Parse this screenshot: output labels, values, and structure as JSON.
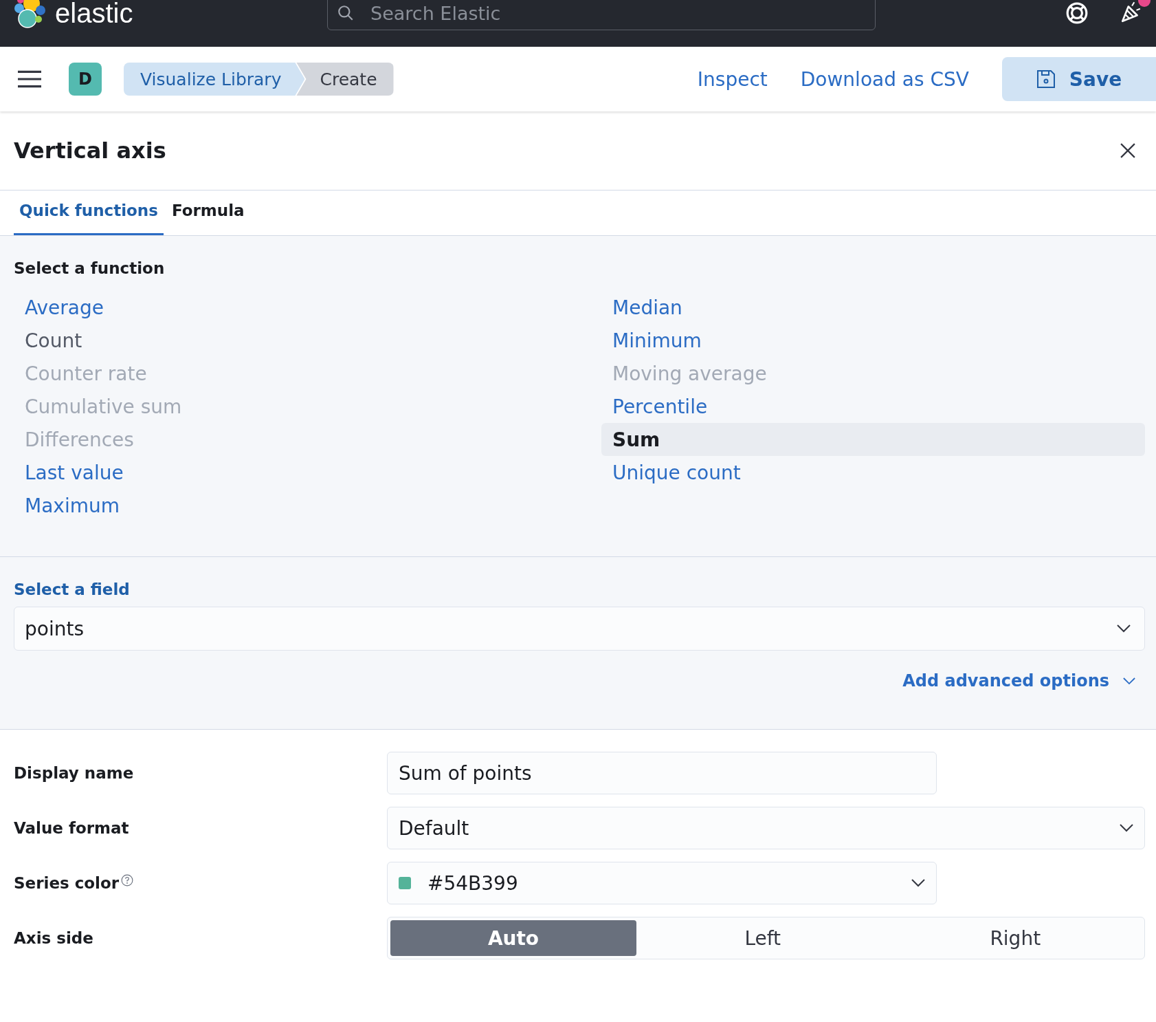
{
  "top_bar": {
    "brand": "elastic",
    "search": {
      "placeholder": "Search Elastic"
    },
    "news_unread": true
  },
  "header": {
    "avatar": "D",
    "breadcrumbs": [
      {
        "label": "Visualize Library",
        "selected": false
      },
      {
        "label": "Create",
        "selected": true
      }
    ],
    "links": [
      "Inspect",
      "Download as CSV"
    ],
    "save_button": "Save"
  },
  "flyout": {
    "title": "Vertical axis",
    "tabs": [
      {
        "label": "Quick functions",
        "selected": true
      },
      {
        "label": "Formula",
        "selected": false
      }
    ],
    "function_label": "Select a function",
    "functions_left": [
      {
        "label": "Average",
        "kind": "compatible",
        "selected": false
      },
      {
        "label": "Count",
        "kind": "incompatible",
        "selected": false
      },
      {
        "label": "Counter rate",
        "kind": "disabled",
        "selected": false
      },
      {
        "label": "Cumulative sum",
        "kind": "disabled",
        "selected": false
      },
      {
        "label": "Differences",
        "kind": "disabled",
        "selected": false
      },
      {
        "label": "Last value",
        "kind": "compatible",
        "selected": false
      },
      {
        "label": "Maximum",
        "kind": "compatible",
        "selected": false
      }
    ],
    "functions_right": [
      {
        "label": "Median",
        "kind": "compatible",
        "selected": false
      },
      {
        "label": "Minimum",
        "kind": "compatible",
        "selected": false
      },
      {
        "label": "Moving average",
        "kind": "disabled",
        "selected": false
      },
      {
        "label": "Percentile",
        "kind": "compatible",
        "selected": false
      },
      {
        "label": "Sum",
        "kind": "compatible",
        "selected": true
      },
      {
        "label": "Unique count",
        "kind": "compatible",
        "selected": false
      }
    ],
    "field_label": "Select a field",
    "field_value": "points",
    "advanced_link": "Add advanced options",
    "display_name": {
      "label": "Display name",
      "value": "Sum of points"
    },
    "value_format": {
      "label": "Value format",
      "value": "Default"
    },
    "series_color": {
      "label": "Series color",
      "value": "#54B399",
      "color": "#54b399"
    },
    "axis_side": {
      "label": "Axis side",
      "options": [
        {
          "label": "Auto",
          "selected": true
        },
        {
          "label": "Left",
          "selected": false
        },
        {
          "label": "Right",
          "selected": false
        }
      ]
    }
  }
}
